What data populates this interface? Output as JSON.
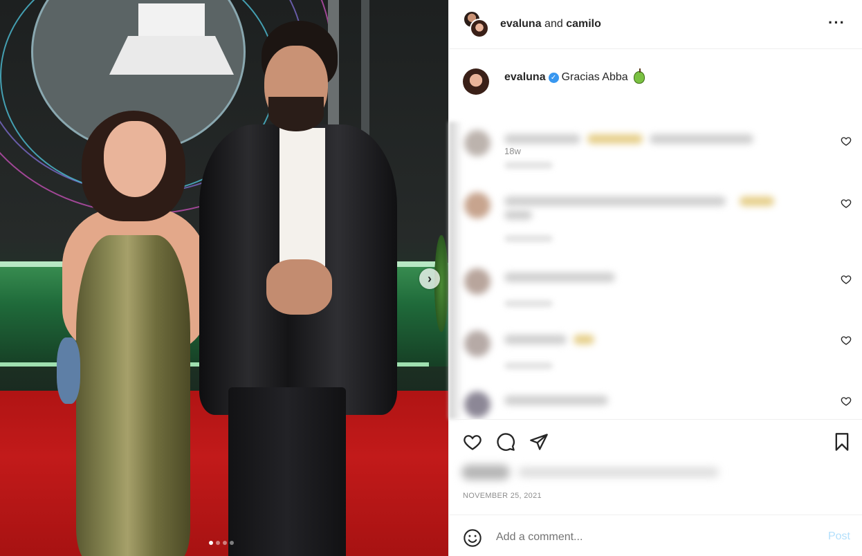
{
  "post": {
    "carousel": {
      "slide_count": 4,
      "active_slide": 1
    },
    "header": {
      "user1": "evaluna",
      "joiner": "and",
      "user2": "camilo",
      "more_icon": "more-horizontal-icon"
    },
    "caption": {
      "username": "evaluna",
      "verified_icon": "verified-badge-icon",
      "text": "Gracias Abba",
      "emoji": "green-apple-emoji",
      "time_ago": "18w"
    },
    "actions": {
      "like_icon": "heart-icon",
      "comment_icon": "comment-icon",
      "share_icon": "share-icon",
      "save_icon": "bookmark-icon"
    },
    "date": "NOVEMBER 25, 2021",
    "comment_box": {
      "placeholder": "Add a comment...",
      "post_label": "Post",
      "emoji_icon": "smile-icon"
    }
  },
  "colors": {
    "accent_blue": "#3897f0",
    "post_disabled": "#b2dffc",
    "muted_text": "#8e8e8e"
  }
}
